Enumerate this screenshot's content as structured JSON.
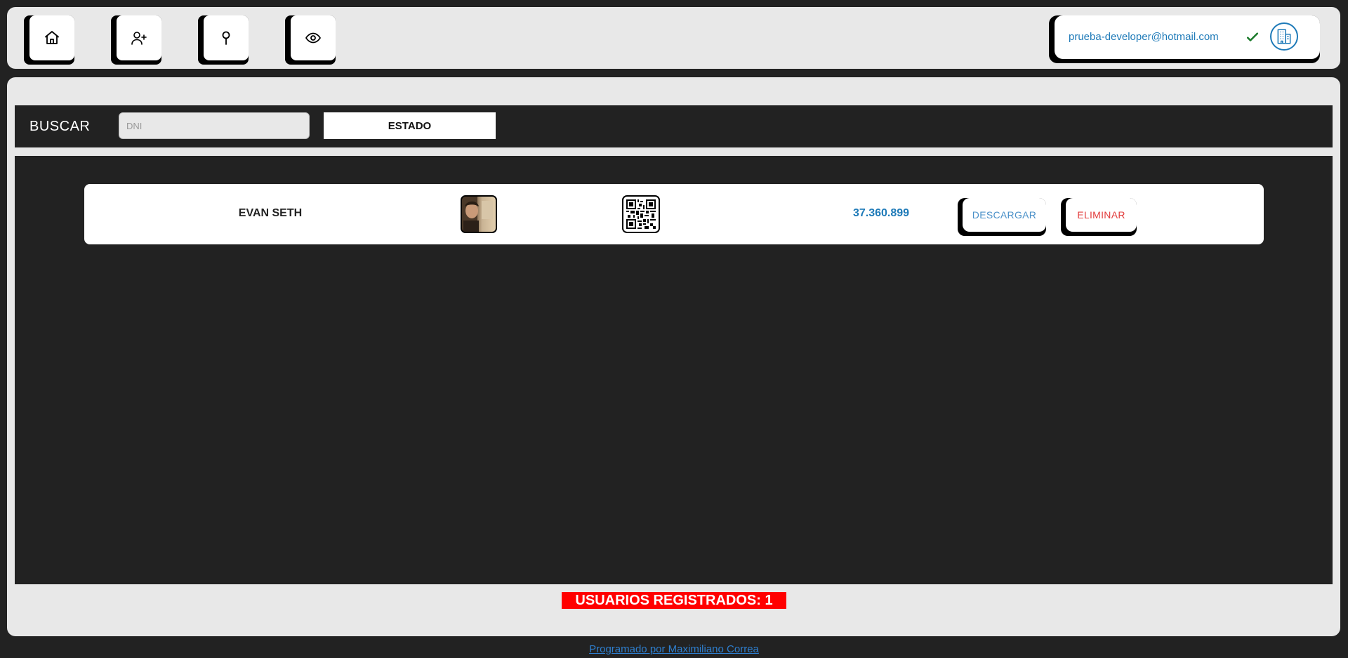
{
  "nav": {
    "items": [
      {
        "name": "home",
        "icon": "home-icon"
      },
      {
        "name": "add-user",
        "icon": "user-plus-icon"
      },
      {
        "name": "location",
        "icon": "map-pin-icon"
      },
      {
        "name": "view",
        "icon": "eye-icon"
      }
    ]
  },
  "user": {
    "email": "prueba-developer@hotmail.com",
    "verified_icon": "check-icon",
    "company_icon": "building-icon"
  },
  "search": {
    "label": "BUSCAR",
    "dni_placeholder": "DNI",
    "dni_value": "",
    "estado_label": "ESTADO"
  },
  "users": [
    {
      "name": "EVAN SETH",
      "dni": "37.360.899",
      "download_label": "DESCARGAR",
      "delete_label": "ELIMINAR"
    }
  ],
  "summary": {
    "registered_label": "USUARIOS REGISTRADOS: 1"
  },
  "footer": {
    "credit": "Programado por Maximiliano Correa"
  },
  "colors": {
    "accent_blue": "#1e7ab8",
    "danger_red": "#e23b3b",
    "badge_red": "#ff0000",
    "dark_bg": "#222222",
    "panel_bg": "#e8e8e8"
  }
}
